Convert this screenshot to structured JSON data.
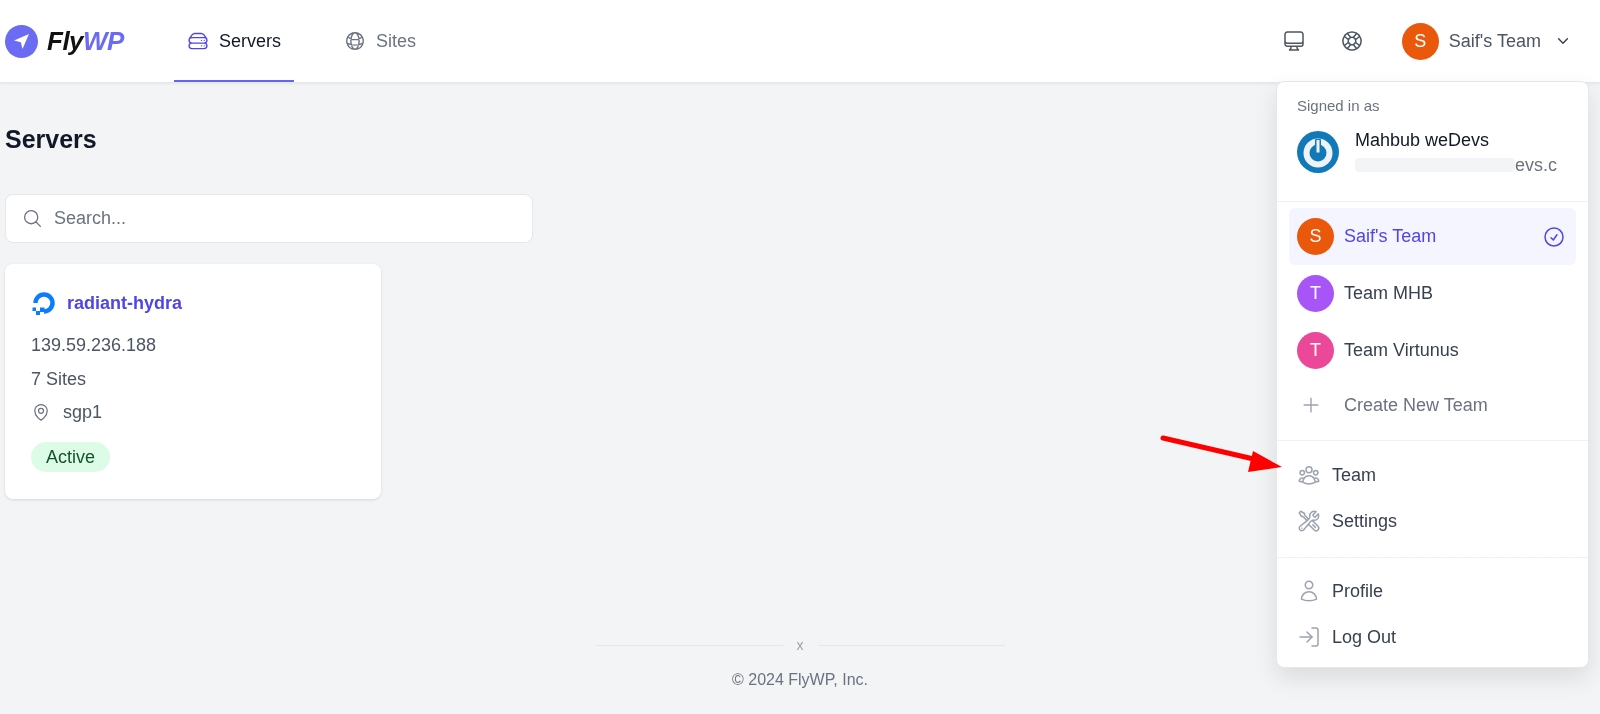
{
  "header": {
    "logo": {
      "part_1": "Fly",
      "part_2": "WP"
    },
    "nav": [
      {
        "label": "Servers",
        "selected": true
      },
      {
        "label": "Sites",
        "selected": false
      }
    ],
    "team_button": {
      "initial": "S",
      "label": "Saif's Team"
    }
  },
  "page": {
    "title": "Servers",
    "search": {
      "placeholder": "Search..."
    },
    "servers": [
      {
        "name": "radiant-hydra",
        "ip": "139.59.236.188",
        "sites": "7 Sites",
        "region": "sgp1",
        "status": "Active"
      }
    ]
  },
  "account_menu": {
    "signed_in_label": "Signed in as",
    "user": {
      "name": "Mahbub weDevs",
      "email": "evs.c"
    },
    "teams": [
      {
        "initial": "S",
        "name": "Saif's Team",
        "color": "#ea580c",
        "selected": true
      },
      {
        "initial": "T",
        "name": "Team MHB",
        "color": "#a855f7",
        "selected": false
      },
      {
        "initial": "T",
        "name": "Team Virtunus",
        "color": "#ec4899",
        "selected": false
      }
    ],
    "create_team": "Create New Team",
    "groups": [
      [
        "Team",
        "Settings"
      ],
      [
        "Profile",
        "Log Out"
      ]
    ]
  },
  "footer": {
    "separator": "x",
    "copyright": "© 2024 FlyWP, Inc."
  }
}
